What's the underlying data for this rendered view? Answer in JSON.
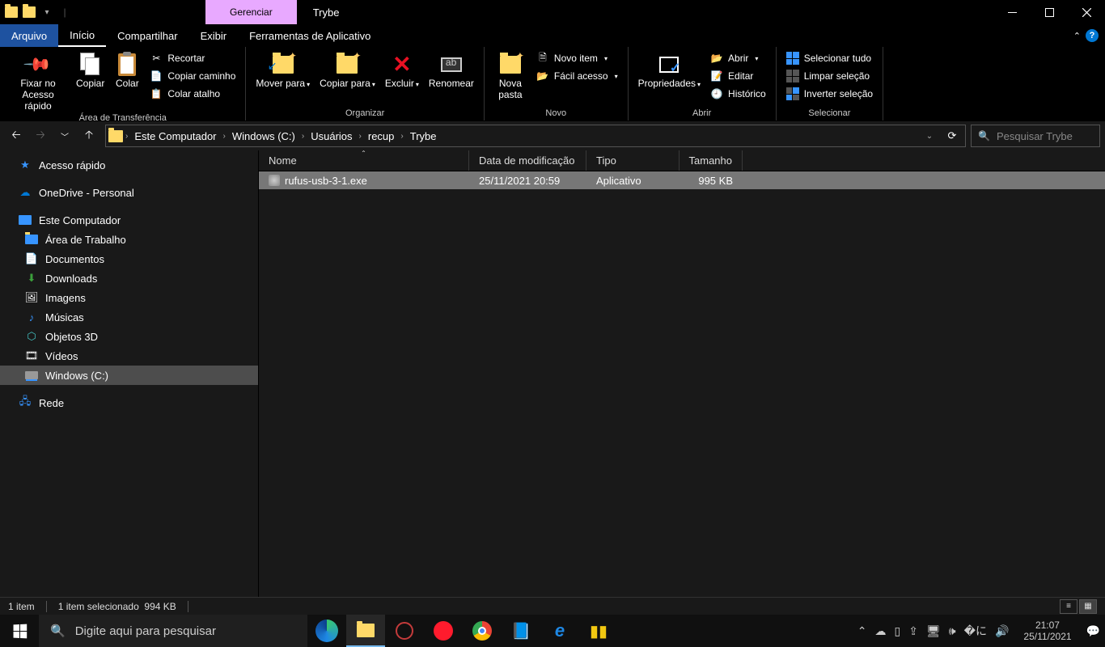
{
  "titlebar": {
    "context_tab": "Gerenciar",
    "title": "Trybe"
  },
  "tabs": {
    "file": "Arquivo",
    "home": "Início",
    "share": "Compartilhar",
    "view": "Exibir",
    "apptools": "Ferramentas de Aplicativo"
  },
  "ribbon": {
    "pin": "Fixar no Acesso rápido",
    "copy": "Copiar",
    "paste": "Colar",
    "cut": "Recortar",
    "copypath": "Copiar caminho",
    "pasteshortcut": "Colar atalho",
    "clipboard_group": "Área de Transferência",
    "moveto": "Mover para",
    "copyto": "Copiar para",
    "delete": "Excluir",
    "rename": "Renomear",
    "organize_group": "Organizar",
    "newfolder": "Nova pasta",
    "newitem": "Novo item",
    "easyaccess": "Fácil acesso",
    "new_group": "Novo",
    "properties": "Propriedades",
    "open": "Abrir",
    "edit": "Editar",
    "history": "Histórico",
    "open_group": "Abrir",
    "selectall": "Selecionar tudo",
    "selectnone": "Limpar seleção",
    "invert": "Inverter seleção",
    "select_group": "Selecionar"
  },
  "breadcrumbs": [
    "Este Computador",
    "Windows (C:)",
    "Usuários",
    "recup",
    "Trybe"
  ],
  "search": {
    "placeholder": "Pesquisar Trybe"
  },
  "sidebar": {
    "quick": "Acesso rápido",
    "onedrive": "OneDrive - Personal",
    "pc": "Este Computador",
    "desktop": "Área de Trabalho",
    "documents": "Documentos",
    "downloads": "Downloads",
    "pictures": "Imagens",
    "music": "Músicas",
    "objects3d": "Objetos 3D",
    "videos": "Vídeos",
    "cdrive": "Windows (C:)",
    "network": "Rede"
  },
  "columns": {
    "name": "Nome",
    "date": "Data de modificação",
    "type": "Tipo",
    "size": "Tamanho"
  },
  "files": [
    {
      "name": "rufus-usb-3-1.exe",
      "date": "25/11/2021 20:59",
      "type": "Aplicativo",
      "size": "995 KB"
    }
  ],
  "status": {
    "count": "1 item",
    "selected": "1 item selecionado",
    "selsize": "994 KB"
  },
  "taskbar": {
    "search_placeholder": "Digite aqui para pesquisar",
    "time": "21:07",
    "date": "25/11/2021"
  }
}
